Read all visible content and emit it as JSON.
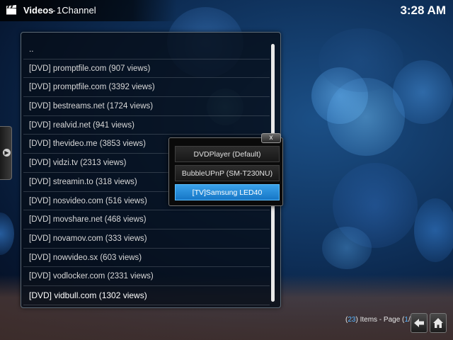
{
  "header": {
    "section": "Videos",
    "separator": "-",
    "addon": "1Channel",
    "clock": "3:28 AM"
  },
  "list": {
    "items": [
      "..",
      "[DVD] promptfile.com  (907 views)",
      "[DVD] promptfile.com  (3392 views)",
      "[DVD] bestreams.net  (1724 views)",
      "[DVD] realvid.net  (941 views)",
      "[DVD] thevideo.me  (3853 views)",
      "[DVD] vidzi.tv  (2313 views)",
      "[DVD] streamin.to  (318 views)",
      "[DVD] nosvideo.com  (516 views)",
      "[DVD] movshare.net  (468 views)",
      "[DVD] novamov.com  (333 views)",
      "[DVD] nowvideo.sx  (603 views)",
      "[DVD] vodlocker.com  (2331 views)",
      "[DVD] vidbull.com  (1302 views)"
    ],
    "selected_index": 13
  },
  "popup": {
    "close_label": "x",
    "options": [
      "DVDPlayer (Default)",
      "BubbleUPnP (SM-T230NU)",
      "[TV]Samsung LED40"
    ],
    "focused_index": 2
  },
  "footer": {
    "open_paren": "(",
    "item_count": "23",
    "items_text": ") Items - Page (",
    "page_current": "1",
    "page_sep": "/",
    "page_total": "2",
    "close_paren": ")"
  },
  "icons": {
    "header": "clapperboard-icon",
    "side": "chevron-right-icon",
    "back": "back-arrow-icon",
    "home": "home-icon"
  },
  "colors": {
    "accent": "#1f87d6",
    "accent_text": "#58b5ff",
    "background": "#0e2f58"
  }
}
